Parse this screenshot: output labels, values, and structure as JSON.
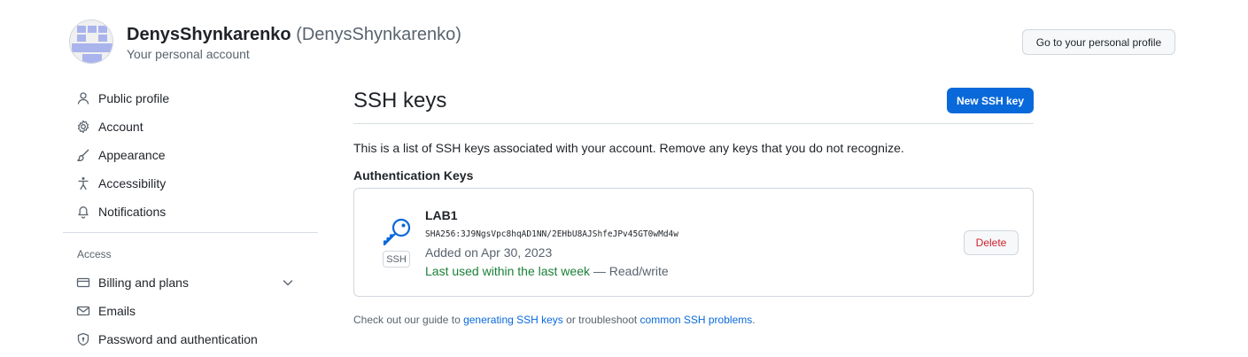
{
  "header": {
    "display_name": "DenysShynkarenko",
    "login": "(DenysShynkarenko)",
    "subtitle": "Your personal account",
    "profile_button": "Go to your personal profile"
  },
  "sidebar": {
    "items": [
      {
        "label": "Public profile",
        "icon": "person-icon"
      },
      {
        "label": "Account",
        "icon": "gear-icon"
      },
      {
        "label": "Appearance",
        "icon": "paintbrush-icon"
      },
      {
        "label": "Accessibility",
        "icon": "accessibility-icon"
      },
      {
        "label": "Notifications",
        "icon": "bell-icon"
      }
    ],
    "access_heading": "Access",
    "access_items": [
      {
        "label": "Billing and plans",
        "icon": "credit-card-icon"
      },
      {
        "label": "Emails",
        "icon": "mail-icon"
      },
      {
        "label": "Password and authentication",
        "icon": "shield-lock-icon"
      }
    ]
  },
  "main": {
    "title": "SSH keys",
    "new_button": "New SSH key",
    "intro": "This is a list of SSH keys associated with your account. Remove any keys that you do not recognize.",
    "auth_heading": "Authentication Keys",
    "key": {
      "badge": "SSH",
      "title": "LAB1",
      "fingerprint": "SHA256:3J9NgsVpc8hqAD1NN/2EHbU8AJShfeJPv45GT0wMd4w",
      "added": "Added on Apr 30, 2023",
      "last_used": "Last used within the last week",
      "access": "— Read/write",
      "delete_label": "Delete"
    },
    "footer": {
      "prefix": "Check out our guide to ",
      "link1": "generating SSH keys",
      "middle": " or troubleshoot ",
      "link2": "common SSH problems",
      "suffix": "."
    }
  },
  "colors": {
    "accent": "#0969da",
    "danger": "#cf222e",
    "success": "#1a7f37",
    "avatar": "#aab4ec"
  }
}
